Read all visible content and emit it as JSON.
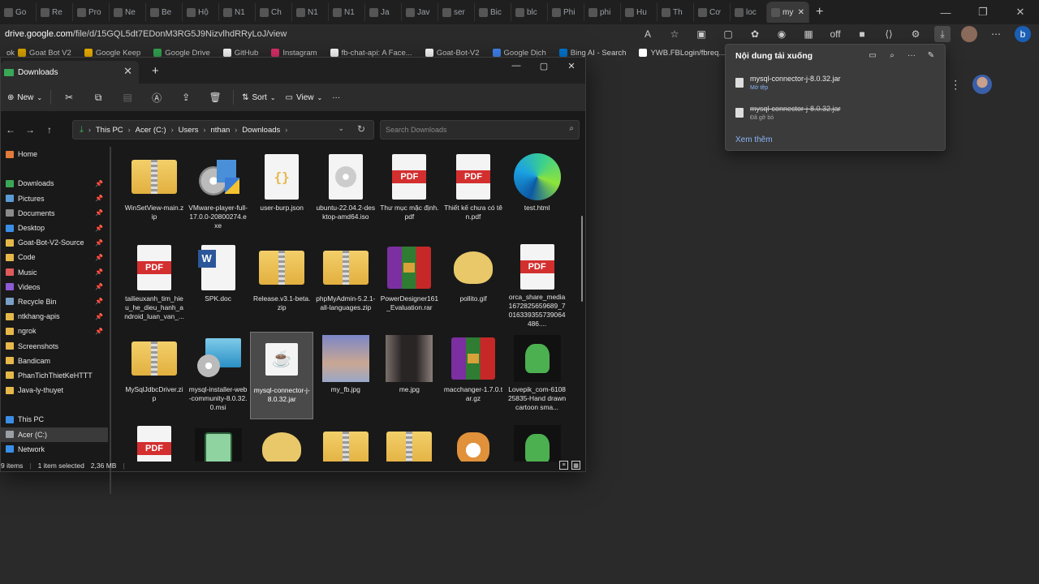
{
  "browser": {
    "tabs": [
      {
        "label": "Go"
      },
      {
        "label": "Re"
      },
      {
        "label": "Pro"
      },
      {
        "label": "Ne"
      },
      {
        "label": "Be"
      },
      {
        "label": "Hộ"
      },
      {
        "label": "N1"
      },
      {
        "label": "Ch"
      },
      {
        "label": "N1"
      },
      {
        "label": "N1"
      },
      {
        "label": "Ja"
      },
      {
        "label": "Jav"
      },
      {
        "label": "ser"
      },
      {
        "label": "Bic"
      },
      {
        "label": "blc"
      },
      {
        "label": "Phi"
      },
      {
        "label": "phi"
      },
      {
        "label": "Hu"
      },
      {
        "label": "Th"
      },
      {
        "label": "Cơ"
      },
      {
        "label": "loc"
      },
      {
        "label": "my",
        "active": true
      }
    ],
    "new_tab": "+",
    "window_controls": {
      "minimize": "—",
      "maximize": "❐",
      "close": "✕"
    },
    "url_host": "drive.google.com",
    "url_path": "/file/d/15GQL5dt7EDonM3RG5J9NizvlhdRRyLoJ/view",
    "toolbar_icons": [
      "A",
      "☆",
      "▣",
      "▢",
      "✿",
      "◉",
      "▦",
      "off",
      "■",
      "⟨⟩",
      "⚙",
      "⤓",
      "●",
      "⋯",
      "b"
    ],
    "bookmarks": [
      {
        "label": "Goat Bot V2",
        "prefix": "ok",
        "color": "#e0a800"
      },
      {
        "label": "Google Keep",
        "color": "#f4b400"
      },
      {
        "label": "Google Drive",
        "color": "#34a853"
      },
      {
        "label": "GitHub",
        "color": "#ffffff"
      },
      {
        "label": "Instagram",
        "color": "#e1306c"
      },
      {
        "label": "fb-chat-api: A Face...",
        "color": "#ffffff"
      },
      {
        "label": "Goat-Bot-V2",
        "color": "#ffffff"
      },
      {
        "label": "Google Dịch",
        "color": "#4285f4"
      },
      {
        "label": "Bing AI - Search",
        "color": "#0078d4"
      },
      {
        "label": "YWB.FBLogin/fbreq...",
        "color": "#ffffff"
      }
    ]
  },
  "explorer": {
    "tab_title": "Downloads",
    "tab_close": "✕",
    "new_tab": "+",
    "win_controls": {
      "minimize": "—",
      "maximize": "▢",
      "close": "✕"
    },
    "commands": {
      "new": "New",
      "sort": "Sort",
      "view": "View",
      "more": "···"
    },
    "breadcrumb": [
      "This PC",
      "Acer (C:)",
      "Users",
      "nthan",
      "Downloads"
    ],
    "search_placeholder": "Search Downloads",
    "sidebar": [
      {
        "label": "Home",
        "color": "#e07b39",
        "pin": false
      },
      {
        "gap": true
      },
      {
        "label": "Downloads",
        "color": "#3aa757",
        "pin": true
      },
      {
        "label": "Pictures",
        "color": "#5b9bd5",
        "pin": true
      },
      {
        "label": "Documents",
        "color": "#8a8a8a",
        "pin": true
      },
      {
        "label": "Desktop",
        "color": "#3a8ee6",
        "pin": true
      },
      {
        "label": "Goat-Bot-V2-Source",
        "color": "#e6b84a",
        "pin": true
      },
      {
        "label": "Code",
        "color": "#e6b84a",
        "pin": true
      },
      {
        "label": "Music",
        "color": "#e05a5a",
        "pin": true
      },
      {
        "label": "Videos",
        "color": "#8e5ad6",
        "pin": true
      },
      {
        "label": "Recycle Bin",
        "color": "#7aa0c8",
        "pin": true
      },
      {
        "label": "ntkhang-apis",
        "color": "#e6b84a",
        "pin": true
      },
      {
        "label": "ngrok",
        "color": "#e6b84a",
        "pin": true
      },
      {
        "label": "Screenshots",
        "color": "#e6b84a",
        "pin": false
      },
      {
        "label": "Bandicam",
        "color": "#e6b84a",
        "pin": false
      },
      {
        "label": "PhanTichThietKeHTTT",
        "color": "#e6b84a",
        "pin": false
      },
      {
        "label": "Java-ly-thuyet",
        "color": "#e6b84a",
        "pin": false
      },
      {
        "gap": true
      },
      {
        "label": "This PC",
        "color": "#3a8ee6",
        "pin": false
      },
      {
        "label": "Acer (C:)",
        "color": "#9aa0a6",
        "pin": false,
        "selected": true
      },
      {
        "label": "Network",
        "color": "#3a8ee6",
        "pin": false
      }
    ],
    "files": [
      {
        "name": "WinSetView-main.zip",
        "kind": "zip"
      },
      {
        "name": "VMware-player-full-17.0.0-20800274.exe",
        "kind": "exe"
      },
      {
        "name": "user-burp.json",
        "kind": "json"
      },
      {
        "name": "ubuntu-22.04.2-desktop-amd64.iso",
        "kind": "iso"
      },
      {
        "name": "Thư mục mặc định.pdf",
        "kind": "pdf"
      },
      {
        "name": "Thiết kế chưa có tên.pdf",
        "kind": "pdf"
      },
      {
        "name": "test.html",
        "kind": "edge"
      },
      {
        "name": "tailieuxanh_tim_hieu_he_dieu_hanh_android_luan_van_...",
        "kind": "pdf"
      },
      {
        "name": "SPK.doc",
        "kind": "doc"
      },
      {
        "name": "Release.v3.1-beta.zip",
        "kind": "zip"
      },
      {
        "name": "phpMyAdmin-5.2.1-all-languages.zip",
        "kind": "zip"
      },
      {
        "name": "PowerDesigner161_Evaluation.rar",
        "kind": "rar"
      },
      {
        "name": "pollito.gif",
        "kind": "gif"
      },
      {
        "name": "orca_share_media1672825659689_7016339355739064486....",
        "kind": "pdf"
      },
      {
        "name": "MySqlJdbcDriver.zip",
        "kind": "zip"
      },
      {
        "name": "mysql-installer-web-community-8.0.32.0.msi",
        "kind": "msi"
      },
      {
        "name": "mysql-connector-j-8.0.32.jar",
        "kind": "jar",
        "selected": true
      },
      {
        "name": "my_fb.jpg",
        "kind": "photo1"
      },
      {
        "name": "me.jpg",
        "kind": "photo2"
      },
      {
        "name": "macchanger-1.7.0.tar.gz",
        "kind": "rar"
      },
      {
        "name": "Lovepik_com-610825835-Hand drawn cartoon sma...",
        "kind": "dino"
      },
      {
        "name": "",
        "kind": "pdf"
      },
      {
        "name": "",
        "kind": "bmo"
      },
      {
        "name": "",
        "kind": "gif"
      },
      {
        "name": "",
        "kind": "zip"
      },
      {
        "name": "",
        "kind": "zip"
      },
      {
        "name": "",
        "kind": "corgi"
      },
      {
        "name": "",
        "kind": "dino"
      }
    ],
    "status": {
      "count": "9 items",
      "selected": "1 item selected",
      "size": "2,36 MB"
    }
  },
  "download_panel": {
    "title": "Nội dung tải xuống",
    "items": [
      {
        "name": "mysql-connector-j-8.0.32.jar",
        "sub": "Mở tệp",
        "removed": false
      },
      {
        "name": "mysql-connector-j-8.0.32.jar",
        "sub": "Đã gỡ bỏ",
        "removed": true
      }
    ],
    "more": "Xem thêm"
  },
  "colors": {
    "accent_link": "#8ab4f8",
    "folder": "#e6b84a",
    "pdf_red": "#d32f2f"
  }
}
